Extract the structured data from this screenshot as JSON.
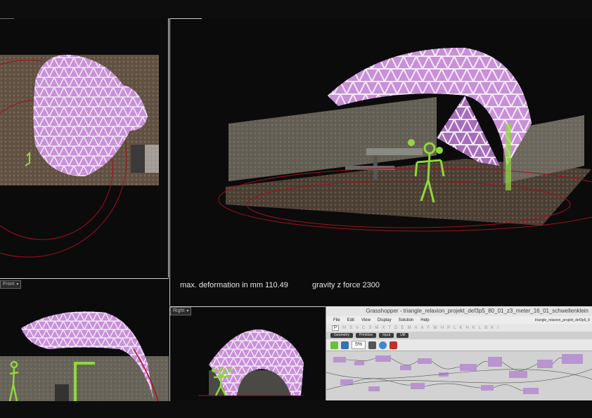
{
  "viewports": {
    "top_left": {
      "label": ""
    },
    "perspective": {
      "label": ""
    },
    "front": {
      "label": "Front"
    },
    "right": {
      "label": "Right"
    }
  },
  "overlay": {
    "deformation": "max. deformation in mm 110.49",
    "gravity": "gravity z force 2300"
  },
  "grasshopper": {
    "title": "Grasshopper - triangle_relaxion_projekt_def3p5_80_01_z3_meter_16_01_schwellenklein",
    "menu": [
      "File",
      "Edit",
      "View",
      "Display",
      "Solution",
      "Help"
    ],
    "document_name": "triangle_relaxion_projekt_def3p5_8",
    "tabs": [
      "P",
      "M",
      "S",
      "V",
      "C",
      "S",
      "M",
      "X",
      "T",
      "D",
      "E",
      "M",
      "A",
      "A",
      "F",
      "W",
      "H",
      "P",
      "L",
      "K",
      "H",
      "K",
      "L",
      "B",
      "K",
      "I"
    ],
    "groups": [
      "Geometry",
      "Primitive",
      "Input",
      "Util"
    ],
    "zoom": "5%"
  },
  "colors": {
    "structure": "#c890d8",
    "structure_light": "#f0e0f4",
    "figure": "#8fd83c",
    "circle": "#b01020"
  }
}
